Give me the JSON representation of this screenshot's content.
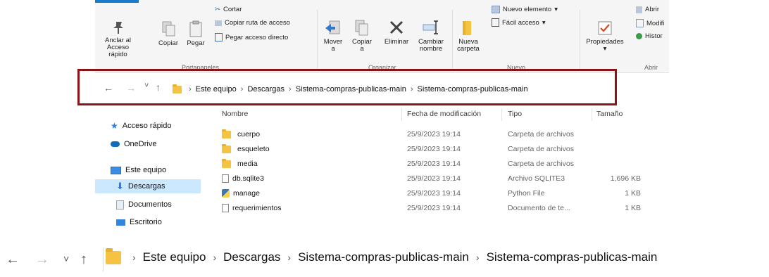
{
  "ribbon": {
    "pin_label_1": "Anclar al",
    "pin_label_2": "Acceso rápido",
    "copy": "Copiar",
    "paste": "Pegar",
    "cut": "Cortar",
    "copy_path": "Copiar ruta de acceso",
    "paste_shortcut": "Pegar acceso directo",
    "group_clipboard": "Portapapeles",
    "move_label_1": "Mover",
    "move_label_2": "a",
    "copy_to_label_1": "Copiar",
    "copy_to_label_2": "a",
    "delete": "Eliminar",
    "rename_1": "Cambiar",
    "rename_2": "nombre",
    "group_organize": "Organizar",
    "new_folder_1": "Nueva",
    "new_folder_2": "carpeta",
    "new_item": "Nuevo elemento",
    "easy_access": "Fácil acceso",
    "group_new": "Nuevo",
    "properties": "Propiedades",
    "open": "Abrir",
    "modify": "Modifi",
    "history": "Histor",
    "group_open": "Abrir"
  },
  "nav": {
    "back": "←",
    "forward": "→",
    "recent": "˅",
    "up": "↑",
    "crumbs": [
      "Este equipo",
      "Descargas",
      "Sistema-compras-publicas-main",
      "Sistema-compras-publicas-main"
    ]
  },
  "sidebar": {
    "items": [
      "Acceso rápido",
      "OneDrive",
      "Este equipo",
      "Descargas",
      "Documentos",
      "Escritorio"
    ]
  },
  "columns": {
    "name": "Nombre",
    "date": "Fecha de modificación",
    "type": "Tipo",
    "size": "Tamaño"
  },
  "files": [
    {
      "name": "cuerpo",
      "date": "25/9/2023 19:14",
      "type": "Carpeta de archivos",
      "size": ""
    },
    {
      "name": "esqueleto",
      "date": "25/9/2023 19:14",
      "type": "Carpeta de archivos",
      "size": ""
    },
    {
      "name": "media",
      "date": "25/9/2023 19:14",
      "type": "Carpeta de archivos",
      "size": ""
    },
    {
      "name": "db.sqlite3",
      "date": "25/9/2023 19:14",
      "type": "Archivo SQLITE3",
      "size": "1,696 KB"
    },
    {
      "name": "manage",
      "date": "25/9/2023 19:14",
      "type": "Python File",
      "size": "1 KB"
    },
    {
      "name": "requerimientos",
      "date": "25/9/2023 19:14",
      "type": "Documento de te...",
      "size": "1 KB"
    }
  ],
  "colors": {
    "highlight_box": "#8b1219",
    "selection": "#cce8ff",
    "folder": "#f4c343",
    "accent": "#1979ca"
  }
}
